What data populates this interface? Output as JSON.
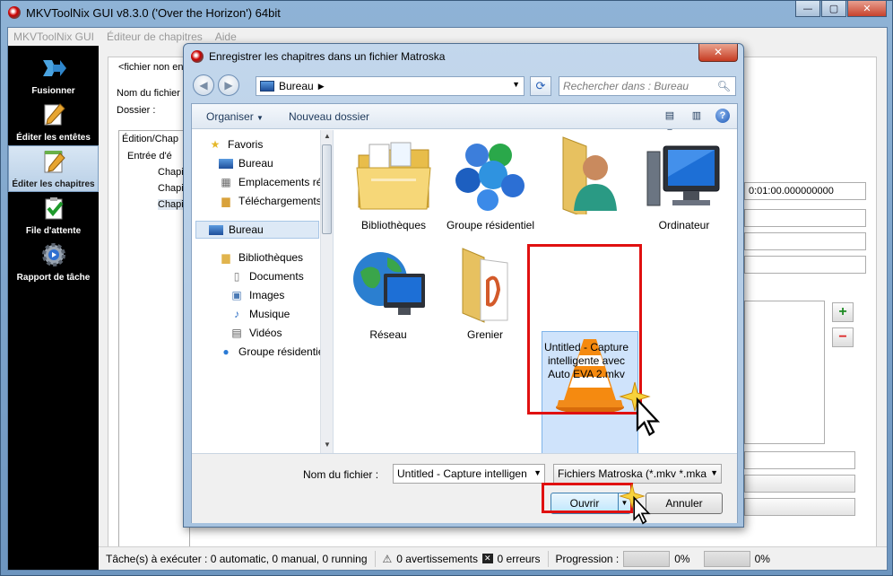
{
  "main_window": {
    "title": "MKVToolNix GUI v8.3.0 ('Over the Horizon') 64bit",
    "buttons": {
      "minimize": "—",
      "maximize": "▢",
      "close": "✕"
    },
    "menu": [
      "MKVToolNix GUI",
      "Éditeur de chapitres",
      "Aide"
    ]
  },
  "sidebar": {
    "items": [
      {
        "label": "Fusionner",
        "icon": "merge-icon"
      },
      {
        "label": "Éditer les entêtes",
        "icon": "pen-icon"
      },
      {
        "label": "Éditer les chapitres",
        "icon": "notepad-icon"
      },
      {
        "label": "File d'attente",
        "icon": "queue-check-icon"
      },
      {
        "label": "Rapport de tâche",
        "icon": "gear-icon"
      }
    ]
  },
  "background": {
    "tab_label": "<fichier non en",
    "file_name_label": "Nom du fichier :",
    "folder_label": "Dossier :",
    "tree_header": "Édition/Chap",
    "tree_items": [
      "Entrée d'é",
      "Chapi",
      "Chapi",
      "Chapi"
    ],
    "time_value": "0:01:00.000000000",
    "add_symbol": "+",
    "remove_symbol": "−"
  },
  "statusbar": {
    "tasks": "Tâche(s) à exécuter : 0 automatic, 0 manual, 0 running",
    "warnings": "0 avertissements",
    "errors": "0 erreurs",
    "progress_label": "Progression :",
    "progress1": "0%",
    "progress2": "0%"
  },
  "dialog": {
    "title": "Enregistrer les chapitres dans un fichier Matroska",
    "close": "✕",
    "address": "Bureau",
    "search_placeholder": "Rechercher dans : Bureau",
    "toolbar": {
      "organize": "Organiser",
      "new_folder": "Nouveau dossier"
    },
    "nav": {
      "favorites": "Favoris",
      "fav_items": [
        "Bureau",
        "Emplacements ré",
        "Téléchargements"
      ],
      "desktop": "Bureau",
      "libraries": "Bibliothèques",
      "lib_items": [
        "Documents",
        "Images",
        "Musique",
        "Vidéos"
      ],
      "homegroup": "Groupe résidentie"
    },
    "files": [
      {
        "label": "Bibliothèques",
        "icon": "libraries-folder-icon"
      },
      {
        "label": "Groupe résidentiel",
        "icon": "homegroup-icon"
      },
      {
        "label": "",
        "icon": "user-folder-icon"
      },
      {
        "label": "Ordinateur",
        "icon": "computer-icon"
      },
      {
        "label": "Réseau",
        "icon": "network-icon"
      },
      {
        "label": "Grenier",
        "icon": "folder-icon"
      },
      {
        "label": "Untitled - Capture intelligente avec Auto EVA 2.mkv",
        "icon": "vlc-cone-icon"
      }
    ],
    "footer": {
      "file_name_label": "Nom du fichier :",
      "file_name_value": "Untitled - Capture intelligen",
      "filter_value": "Fichiers Matroska (*.mkv *.mka",
      "open": "Ouvrir",
      "cancel": "Annuler"
    }
  },
  "colors": {
    "highlight_red": "#e01010",
    "selection": "#cfe3fb",
    "accent": "#3c7fb1"
  }
}
